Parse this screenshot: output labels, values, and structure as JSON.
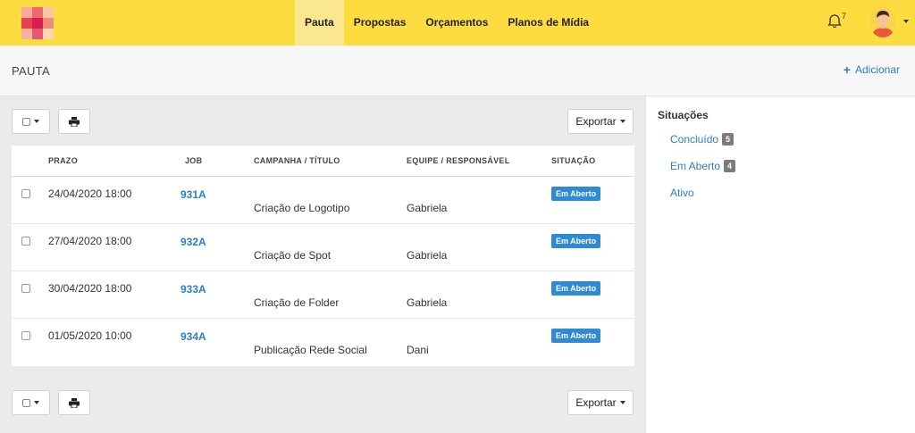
{
  "nav": {
    "items": [
      {
        "label": "Pauta",
        "active": true
      },
      {
        "label": "Propostas",
        "active": false
      },
      {
        "label": "Orçamentos",
        "active": false
      },
      {
        "label": "Planos de Mídia",
        "active": false
      }
    ],
    "notification_count": "7",
    "notification_icon": "bell-icon",
    "avatar_icon": "user-avatar"
  },
  "header": {
    "title": "PAUTA",
    "add_label": "Adicionar",
    "add_icon": "plus-icon"
  },
  "toolbar": {
    "export_label": "Exportar",
    "print_icon": "print-icon"
  },
  "table": {
    "columns": [
      "PRAZO",
      "JOB",
      "CAMPANHA / TÍTULO",
      "EQUIPE / RESPONSÁVEL",
      "SITUAÇÃO"
    ],
    "rows": [
      {
        "prazo": "24/04/2020 18:00",
        "job": "931A",
        "campanha": "Criação de Logotipo",
        "equipe": "Gabriela",
        "situacao": "Em Aberto"
      },
      {
        "prazo": "27/04/2020 18:00",
        "job": "932A",
        "campanha": "Criação de Spot",
        "equipe": "Gabriela",
        "situacao": "Em Aberto"
      },
      {
        "prazo": "30/04/2020 18:00",
        "job": "933A",
        "campanha": "Criação de Folder",
        "equipe": "Gabriela",
        "situacao": "Em Aberto"
      },
      {
        "prazo": "01/05/2020 10:00",
        "job": "934A",
        "campanha": "Publicação Rede Social",
        "equipe": "Dani",
        "situacao": "Em Aberto"
      }
    ]
  },
  "sidebar": {
    "title": "Situações",
    "items": [
      {
        "label": "Concluído",
        "count": "5"
      },
      {
        "label": "Em Aberto",
        "count": "4"
      },
      {
        "label": "Ativo",
        "count": ""
      }
    ]
  },
  "colors": {
    "topbar": "#fddc3f",
    "accent": "#2d7ec4",
    "badge": "#2f8ad6"
  }
}
